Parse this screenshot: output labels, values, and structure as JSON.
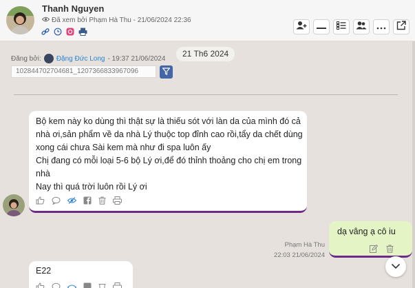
{
  "header": {
    "name": "Thanh Nguyen",
    "seen_text": "Đã xem bởi Phạm Hà Thu - 21/06/2024 22:36",
    "toolbar_icons": [
      "add-user-icon",
      "minus-icon",
      "list-icon",
      "contacts-icon",
      "more-icon",
      "external-link-icon"
    ],
    "info_icons": [
      "link-icon",
      "history-icon",
      "instagram-icon",
      "printer-icon"
    ]
  },
  "date_chip": "21 Th6 2024",
  "posted_by": {
    "label": "Đăng bởi:",
    "who": "Đặng Đức Long",
    "time": "- 19:37 21/06/2024"
  },
  "post_id": "102844702704681_1207366833967096",
  "messages": [
    {
      "lines": [
        "Bộ kem này ko dùng thì thật sự là thiếu sót với làn da của mình đó cả",
        "nhà ơi,sản phẩm về da nhà Lý thuộc top đỉnh cao rồi,tẩy da chết dùng",
        "xong cái chưa Sài kem mà như đi spa luôn ấy",
        "Chị đang có mỗi loại 5-6 bộ Lý ơi,để đó thỉnh thoảng cho chị em trong",
        "nhà",
        "Nay thì quá trời luôn rồi Lý ơi"
      ]
    },
    {
      "text": "dạ vâng ạ cô iu",
      "sender": "Phạm Hà Thu",
      "time": "22:03 21/06/2024"
    },
    {
      "text": "E22"
    }
  ],
  "colors": {
    "background": "#e6e1dc",
    "accent": "#6a2a86",
    "reply_bubble": "#e4f4c4",
    "link": "#2a84d2",
    "filter_button": "#4466a8"
  }
}
